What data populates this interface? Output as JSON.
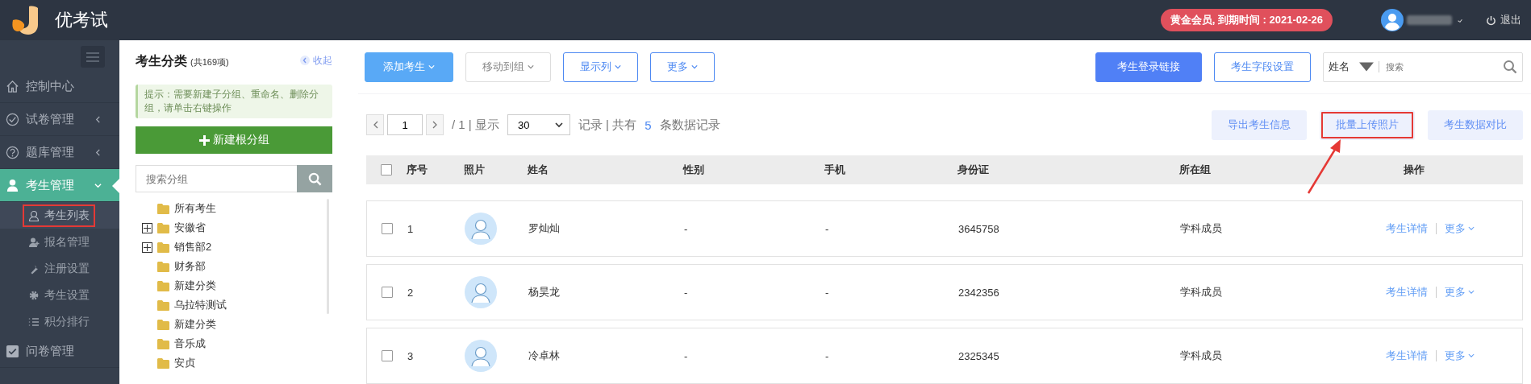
{
  "header": {
    "logo_text": "优考试",
    "membership_badge": "黄金会员, 到期时间 : 2021-02-26",
    "logout": "退出"
  },
  "sidebar": {
    "items": [
      {
        "label": "控制中心",
        "selected": false
      },
      {
        "label": "试卷管理",
        "selected": false,
        "expanded": false
      },
      {
        "label": "题库管理",
        "selected": false,
        "expanded": false
      },
      {
        "label": "考生管理",
        "selected": true,
        "expanded": true,
        "children": [
          {
            "label": "考生列表",
            "selected": true,
            "highlighted": true
          },
          {
            "label": "报名管理",
            "selected": false,
            "highlighted": false
          },
          {
            "label": "注册设置",
            "selected": false,
            "highlighted": false
          },
          {
            "label": "考生设置",
            "selected": false,
            "highlighted": false
          },
          {
            "label": "积分排行",
            "selected": false,
            "highlighted": false
          }
        ]
      },
      {
        "label": "问卷管理",
        "selected": false
      }
    ]
  },
  "category_panel": {
    "title": "考生分类",
    "count": "(共169项)",
    "collapse": "收起",
    "tip": "提示：需要新建子分组、重命名、删除分组，请单击右键操作",
    "new_root_button": "新建根分组",
    "search": {
      "placeholder": "搜索分组"
    },
    "tree": [
      {
        "label": "所有考生",
        "kind": "leaf"
      },
      {
        "label": "安徽省",
        "kind": "group"
      },
      {
        "label": "销售部2",
        "kind": "group"
      },
      {
        "label": "财务部",
        "kind": "leaf"
      },
      {
        "label": "新建分类",
        "kind": "leaf"
      },
      {
        "label": "乌拉特测试",
        "kind": "leaf"
      },
      {
        "label": "新建分类",
        "kind": "leaf"
      },
      {
        "label": "音乐成",
        "kind": "leaf"
      },
      {
        "label": "安贞",
        "kind": "leaf"
      }
    ]
  },
  "toolbar": {
    "left_buttons": [
      {
        "label": "添加考生",
        "kind": "primary"
      },
      {
        "label": "移动到组",
        "kind": "muted"
      },
      {
        "label": "显示列",
        "kind": "outline"
      },
      {
        "label": "更多",
        "kind": "outline"
      }
    ],
    "right_buttons": [
      {
        "label": "考生登录链接",
        "kind": "solid"
      },
      {
        "label": "考生字段设置",
        "kind": "outline"
      }
    ],
    "search": {
      "field": "姓名",
      "placeholder": "搜索"
    }
  },
  "pagination": {
    "page": "1",
    "total": "/ 1 | 显示",
    "page_size": "30",
    "summary_prefix": "记录 | 共有",
    "count": "5",
    "summary_suffix": "条数据记录"
  },
  "actions": [
    {
      "label": "导出考生信息",
      "highlighted": false
    },
    {
      "label": "批量上传照片",
      "highlighted": true
    },
    {
      "label": "考生数据对比",
      "highlighted": false
    }
  ],
  "table": {
    "header_checked": false,
    "columns": [
      "序号",
      "照片",
      "姓名",
      "性别",
      "手机",
      "身份证",
      "所在组",
      "操作"
    ],
    "rows": [
      {
        "checked": false,
        "no": "1",
        "name": "罗灿灿",
        "gender": "-",
        "phone": "-",
        "id_card": "3645758",
        "group": "学科成员",
        "detail": "考生详情",
        "more": "更多"
      },
      {
        "checked": false,
        "no": "2",
        "name": "杨昊龙",
        "gender": "-",
        "phone": "-",
        "id_card": "2342356",
        "group": "学科成员",
        "detail": "考生详情",
        "more": "更多"
      },
      {
        "checked": false,
        "no": "3",
        "name": "冷卓林",
        "gender": "-",
        "phone": "-",
        "id_card": "2325345",
        "group": "学科成员",
        "detail": "考生详情",
        "more": "更多"
      }
    ]
  }
}
